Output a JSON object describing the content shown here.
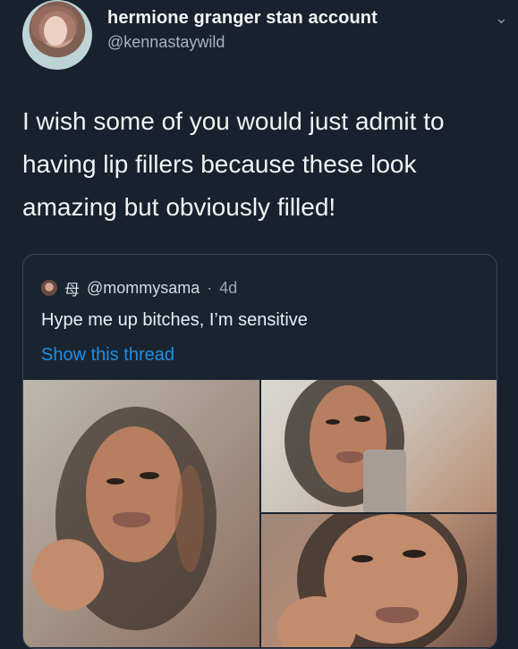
{
  "tweet": {
    "display_name": "hermione granger stan account",
    "handle": "@kennastaywild",
    "text": "I wish some of you would just admit to having lip fillers because these look amazing but obviously filled!"
  },
  "quoted_tweet": {
    "handle": "@mommysama",
    "separator": "·",
    "time": "4d",
    "text": "Hype me up bitches, I’m sensitive",
    "show_thread": "Show this thread",
    "icon": "母"
  },
  "colors": {
    "background": "#18212d",
    "link": "#1f8ee6",
    "border": "#3b4654"
  },
  "icons": {
    "menu": "chevron-down-icon"
  }
}
